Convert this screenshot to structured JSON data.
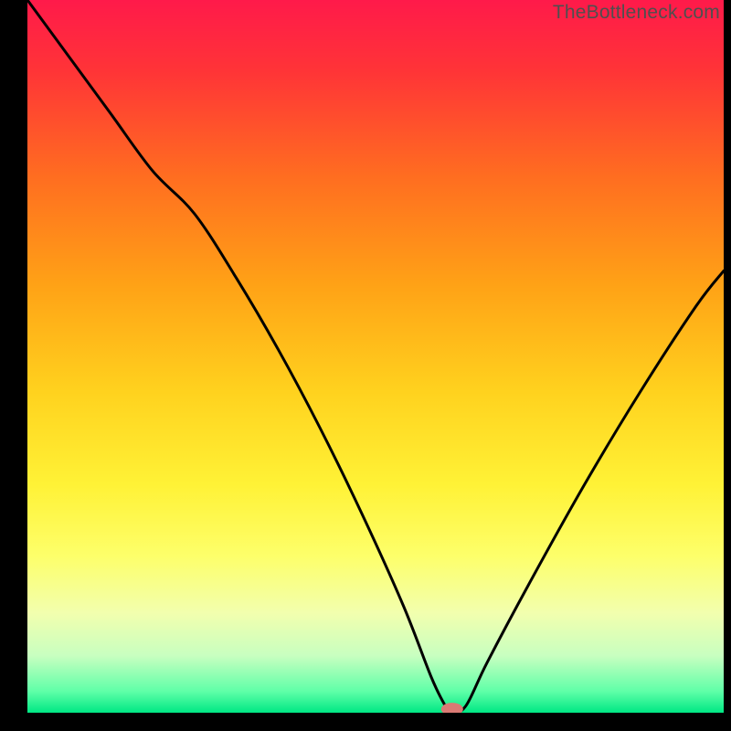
{
  "watermark": "TheBottleneck.com",
  "chart_data": {
    "type": "line",
    "title": "",
    "xlabel": "",
    "ylabel": "",
    "x_range": [
      0,
      100
    ],
    "y_range": [
      0,
      100
    ],
    "grid": false,
    "legend": false,
    "background": {
      "type": "vertical-gradient",
      "stops": [
        {
          "offset": 0.0,
          "color": "#ff1a4a"
        },
        {
          "offset": 0.1,
          "color": "#ff3437"
        },
        {
          "offset": 0.25,
          "color": "#ff6e20"
        },
        {
          "offset": 0.4,
          "color": "#ffa216"
        },
        {
          "offset": 0.55,
          "color": "#ffd21e"
        },
        {
          "offset": 0.68,
          "color": "#fff236"
        },
        {
          "offset": 0.78,
          "color": "#fdff6a"
        },
        {
          "offset": 0.86,
          "color": "#f2ffae"
        },
        {
          "offset": 0.92,
          "color": "#c8ffc0"
        },
        {
          "offset": 0.97,
          "color": "#5fffa8"
        },
        {
          "offset": 1.0,
          "color": "#00e884"
        }
      ]
    },
    "series": [
      {
        "name": "bottleneck-curve",
        "color": "#000000",
        "width": 3,
        "x": [
          0,
          6,
          12,
          18,
          24,
          30,
          36,
          42,
          48,
          54,
          58,
          60,
          61,
          63,
          66,
          72,
          80,
          88,
          96,
          100
        ],
        "y": [
          100,
          92,
          84,
          76,
          70,
          61,
          51,
          40,
          28,
          15,
          5,
          1,
          0,
          1,
          7,
          18,
          32,
          45,
          57,
          62
        ]
      }
    ],
    "marker": {
      "name": "current-point",
      "x": 61,
      "y": 0.5,
      "color": "#da7a74",
      "rx": 12,
      "ry": 7
    },
    "frame": {
      "left_width": 30,
      "right_width": 8,
      "bottom_height": 20,
      "top_height": 0,
      "color": "#000000"
    }
  }
}
